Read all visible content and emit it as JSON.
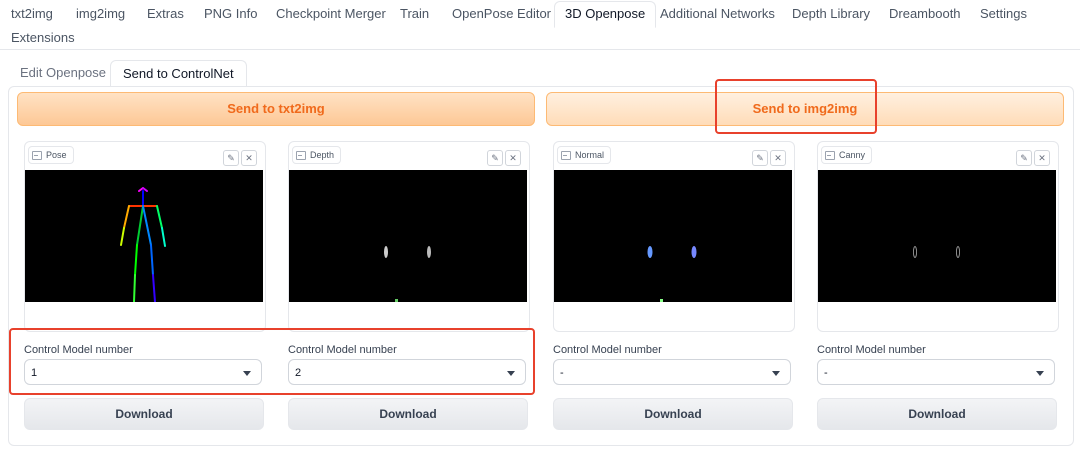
{
  "top_tabs": [
    "txt2img",
    "img2img",
    "Extras",
    "PNG Info",
    "Checkpoint Merger",
    "Train",
    "OpenPose Editor",
    "3D Openpose",
    "Additional Networks",
    "Depth Library",
    "Dreambooth",
    "Settings",
    "Extensions"
  ],
  "active_top_tab": "3D Openpose",
  "sub_tabs": [
    "Edit Openpose",
    "Send to ControlNet"
  ],
  "active_sub_tab": "Send to ControlNet",
  "send_txt2img": "Send to txt2img",
  "send_img2img": "Send to img2img",
  "cards": [
    {
      "label": "Pose"
    },
    {
      "label": "Depth"
    },
    {
      "label": "Normal"
    },
    {
      "label": "Canny"
    }
  ],
  "control_model_label": "Control Model number",
  "selects": [
    "1",
    "2",
    "-",
    "-"
  ],
  "download_label": "Download",
  "icons": {
    "edit": "pencil-icon",
    "clear": "close-icon",
    "image": "image-icon",
    "dropdown": "chevron-down-icon"
  },
  "colors": {
    "accent": "#f06a1c",
    "highlight": "#e8412c"
  }
}
